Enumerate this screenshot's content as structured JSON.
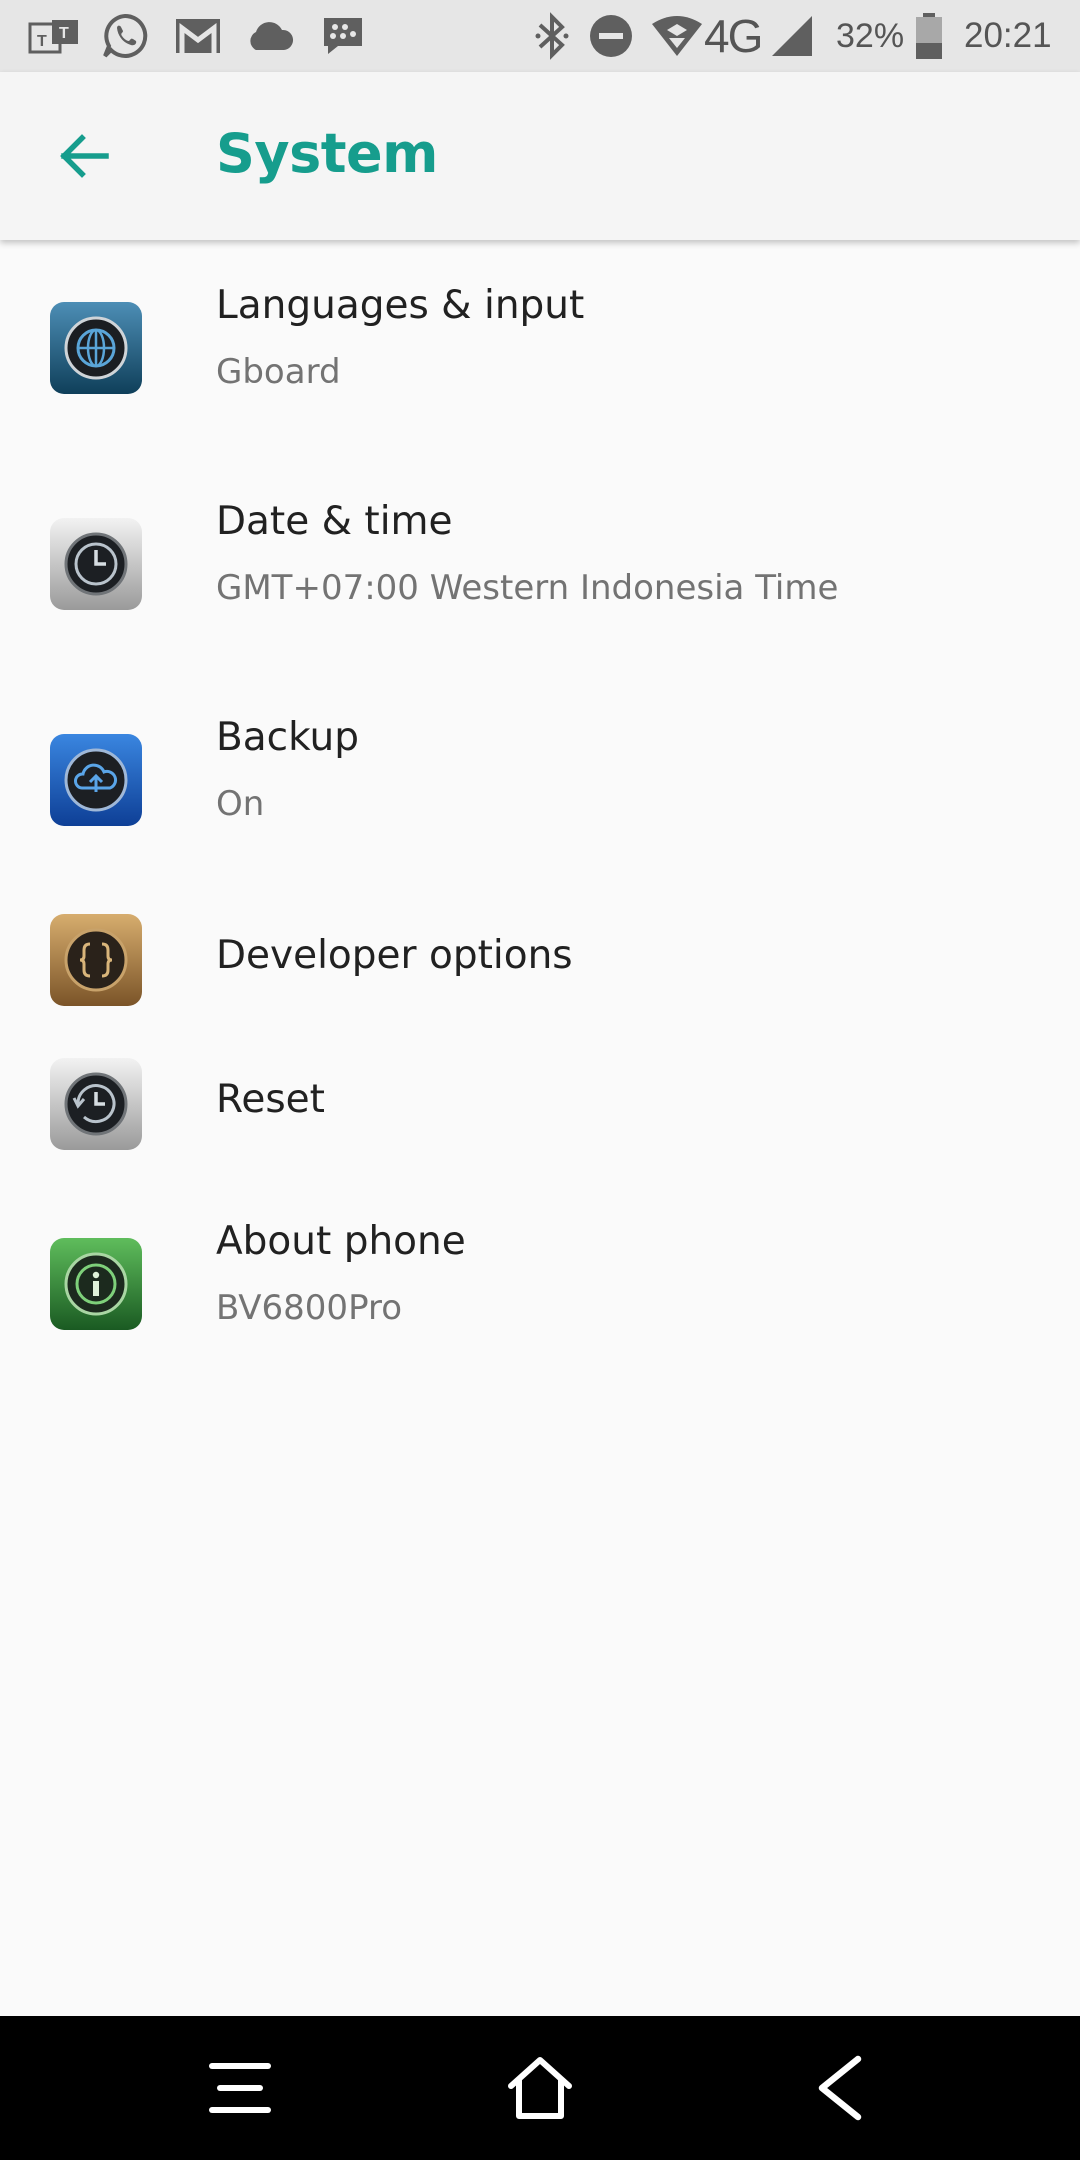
{
  "status_bar": {
    "battery_percent": "32%",
    "time": "20:21",
    "network": "4G",
    "notification_icons": [
      "teams-icon",
      "whatsapp-icon",
      "gmail-icon",
      "cloud-icon",
      "bbm-icon"
    ],
    "system_icons": [
      "bluetooth-icon",
      "do-not-disturb-icon",
      "wifi-icon",
      "signal-icon",
      "battery-icon"
    ]
  },
  "header": {
    "title": "System",
    "accent_color": "#169d8d"
  },
  "items": [
    {
      "title": "Languages & input",
      "subtitle": "Gboard",
      "icon": "globe-icon"
    },
    {
      "title": "Date & time",
      "subtitle": "GMT+07:00 Western Indonesia Time",
      "icon": "clock-icon"
    },
    {
      "title": "Backup",
      "subtitle": "On",
      "icon": "cloud-upload-icon"
    },
    {
      "title": "Developer options",
      "icon": "developer-icon"
    },
    {
      "title": "Reset",
      "icon": "reset-icon"
    },
    {
      "title": "About phone",
      "subtitle": "BV6800Pro",
      "icon": "info-icon"
    }
  ],
  "nav_bar": {
    "buttons": [
      "menu-icon",
      "home-icon",
      "back-icon"
    ]
  }
}
